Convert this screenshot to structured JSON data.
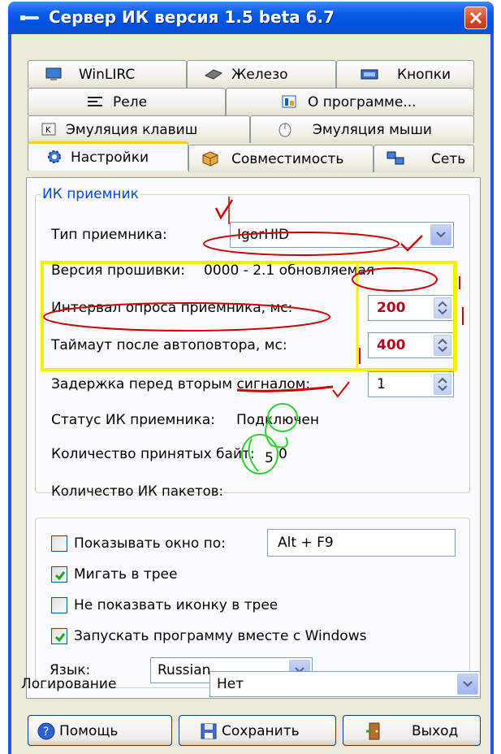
{
  "window": {
    "title": "Сервер ИК версия 1.5 beta 6.7"
  },
  "tabs": {
    "row1": [
      "WinLIRC",
      "Железо",
      "Кнопки"
    ],
    "row2": [
      "Реле",
      "О программе..."
    ],
    "row3": [
      "Эмуляция клавиш",
      "Эмуляция мыши"
    ],
    "row4": [
      "Настройки",
      "Совместимость",
      "Сеть"
    ]
  },
  "receiver_group": {
    "legend": "ИК приемник",
    "type_label": "Тип приемника:",
    "type_value": "IgorHID",
    "firmware_label": "Версия прошивки:",
    "firmware_value": "0000 - 2.1 обновляемая",
    "poll_label": "Интервал опроса приемника, мс:",
    "poll_value": "200",
    "timeout_label": "Таймаут после автоповтора, мс:",
    "timeout_value": "400",
    "delay_label": "Задержка перед вторым сигналом:",
    "delay_value": "1",
    "status_label": "Статус ИК приемника:",
    "status_value": "Подключен",
    "bytes_label": "Количество принятых байт:",
    "bytes_value": "0",
    "packets_label": "Количество ИК пакетов:",
    "packets_value": "5"
  },
  "options": {
    "show_window_label": "Показывать окно по:",
    "show_window_checked": false,
    "hotkey_value": "Alt + F9",
    "blink_label": "Мигать в трее",
    "blink_checked": true,
    "hide_icon_label": "Не показвать иконку в трее",
    "hide_icon_checked": false,
    "autostart_label": "Запускать программу вместе с Windows",
    "autostart_checked": true,
    "language_label": "Язык:",
    "language_value": "Russian"
  },
  "logging": {
    "label": "Логирование",
    "value": "Нет"
  },
  "buttons": {
    "help": "Помощь",
    "save": "Сохранить",
    "exit": "Выход"
  },
  "colors": {
    "titlebar": "#0a5ce6",
    "window_bg": "#ece9d8",
    "legend": "#0046d5",
    "annot_red": "#cc0000",
    "annot_yellow": "#f5f000",
    "annot_green": "#33cc33"
  }
}
